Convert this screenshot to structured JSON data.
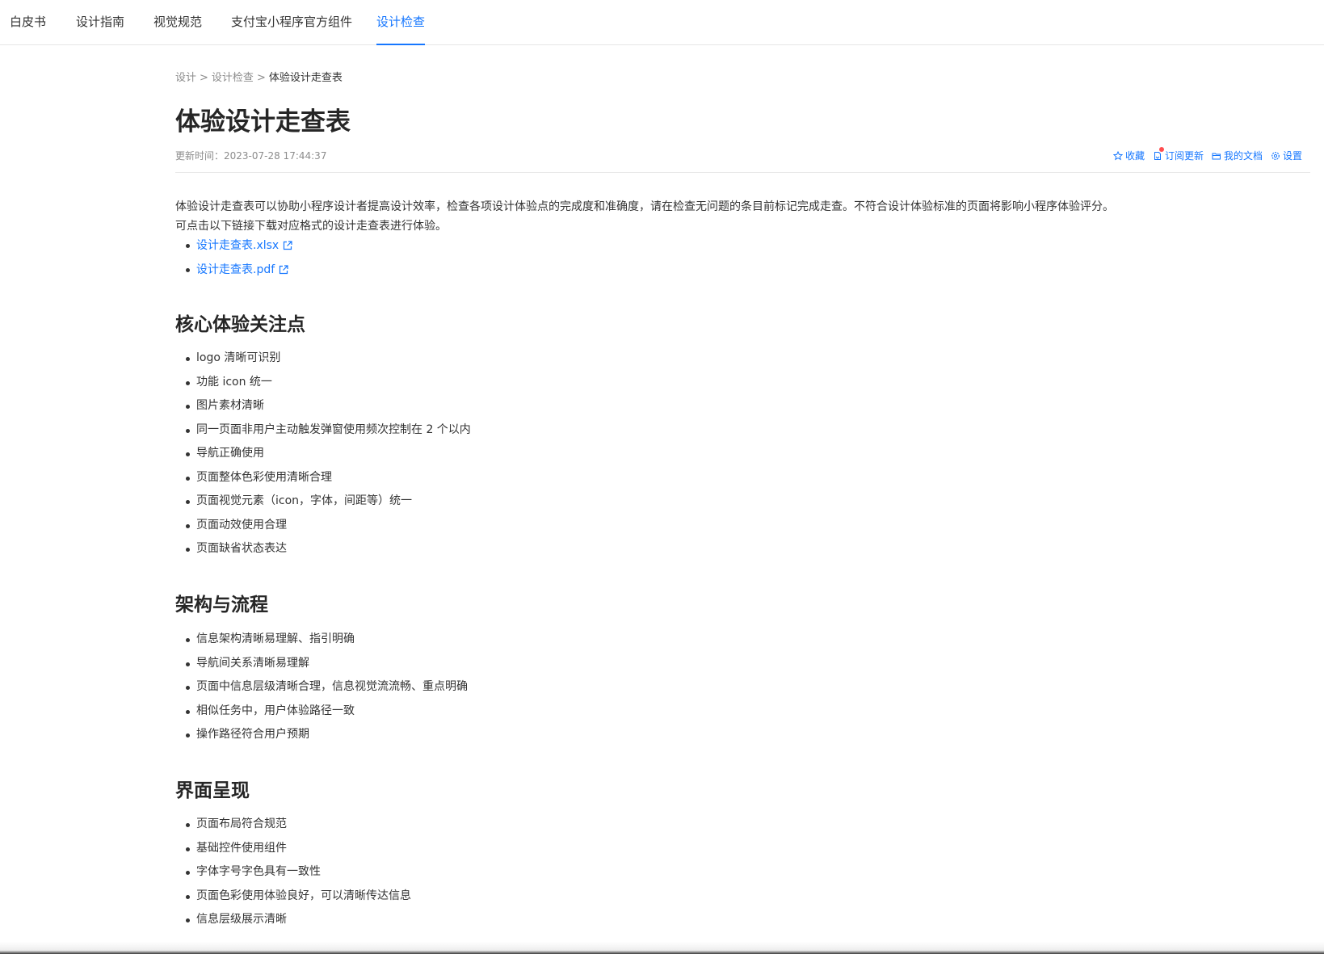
{
  "nav": {
    "tabs": [
      {
        "label": "白皮书"
      },
      {
        "label": "设计指南"
      },
      {
        "label": "视觉规范"
      },
      {
        "label": "支付宝小程序官方组件"
      },
      {
        "label": "设计检查"
      }
    ],
    "active_tab": "设计检查"
  },
  "breadcrumb": {
    "items": [
      "设计",
      "设计检查",
      "体验设计走查表"
    ],
    "separator": ">"
  },
  "page": {
    "title": "体验设计走查表",
    "updated": "更新时间：2023-07-28 17:44:37"
  },
  "actions": {
    "favorite": "收藏",
    "subscribe": "订阅更新",
    "my_docs": "我的文档",
    "settings": "设置"
  },
  "intro": {
    "line1": "体验设计走查表可以协助小程序设计者提高设计效率，检查各项设计体验点的完成度和准确度，请在检查无问题的条目前标记完成走查。不符合设计体验标准的页面将影响小程序体验评分。",
    "line2": "可点击以下链接下载对应格式的设计走查表进行体验。"
  },
  "downloads": [
    {
      "label": "设计走查表.xlsx"
    },
    {
      "label": "设计走查表.pdf"
    }
  ],
  "sections": [
    {
      "title": "核心体验关注点",
      "items": [
        "logo 清晰可识别",
        "功能 icon 统一",
        "图片素材清晰",
        "同一页面非用户主动触发弹窗使用频次控制在 2 个以内",
        "导航正确使用",
        "页面整体色彩使用清晰合理",
        "页面视觉元素（icon，字体，间距等）统一",
        "页面动效使用合理",
        "页面缺省状态表达"
      ]
    },
    {
      "title": "架构与流程",
      "items": [
        "信息架构清晰易理解、指引明确",
        "导航间关系清晰易理解",
        "页面中信息层级清晰合理，信息视觉流流畅、重点明确",
        "相似任务中，用户体验路径一致",
        "操作路径符合用户预期"
      ]
    },
    {
      "title": "界面呈现",
      "items": [
        "页面布局符合规范",
        "基础控件使用组件",
        "字体字号字色具有一致性",
        "页面色彩使用体验良好，可以清晰传达信息",
        "信息层级展示清晰"
      ]
    }
  ],
  "colors": {
    "accent": "#1677ff",
    "text": "#333333",
    "muted": "#8c8c8c",
    "badge": "#ff4d4f"
  }
}
